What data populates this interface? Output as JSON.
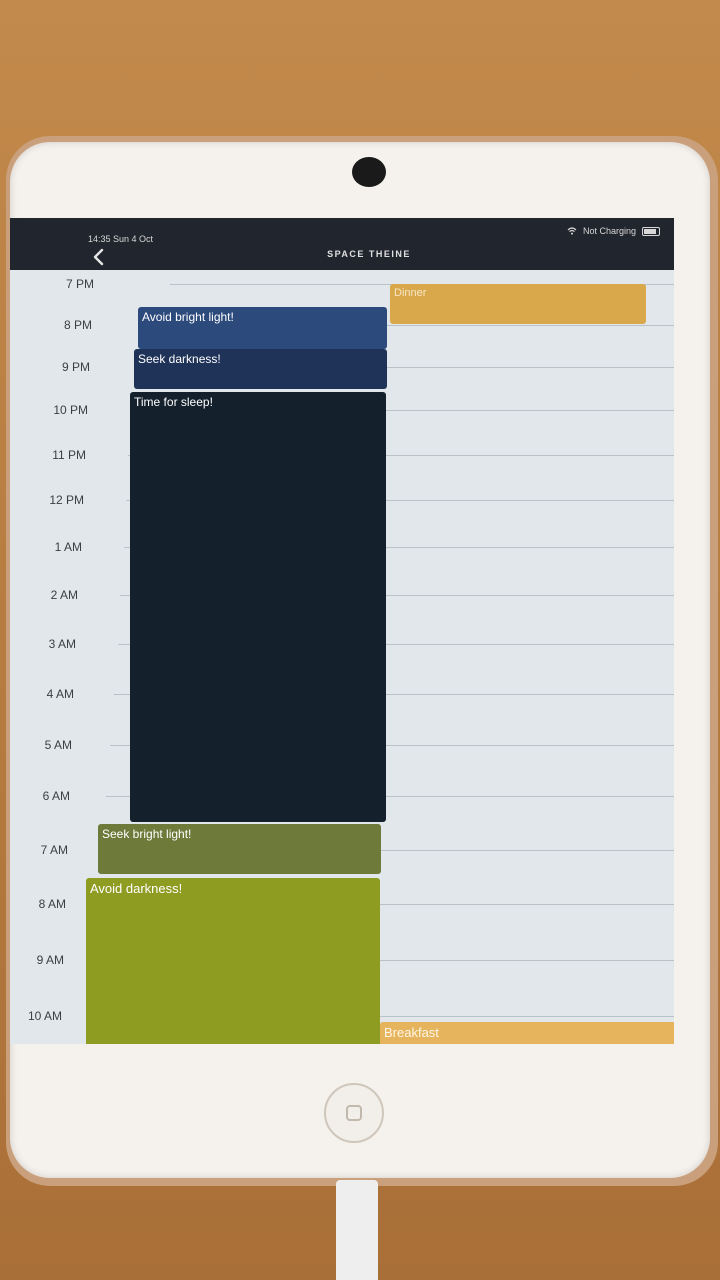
{
  "status_bar": {
    "time": "14:35  Sun 4 Oct",
    "charging": "Not Charging"
  },
  "nav": {
    "title": "SPACE THEINE",
    "back_icon": "chevron-left-icon"
  },
  "timeline": {
    "hours": [
      "7 PM",
      "8 PM",
      "9 PM",
      "10 PM",
      "11 PM",
      "12 PM",
      "1 AM",
      "2 AM",
      "3 AM",
      "4 AM",
      "5 AM",
      "6 AM",
      "7 AM",
      "8 AM",
      "9 AM",
      "10 AM"
    ],
    "events": [
      {
        "title": "Avoid bright light!",
        "color": "#2c4a7c"
      },
      {
        "title": "Seek darkness!",
        "color": "#1f3358"
      },
      {
        "title": "Time for sleep!",
        "color": "#14202c"
      },
      {
        "title": "Seek bright light!",
        "color": "#6d7a3a"
      },
      {
        "title": "Avoid darkness!",
        "color": "#8e9c22"
      },
      {
        "title": "Dinner",
        "color": "#d9a84a"
      },
      {
        "title": "Breakfast",
        "color": "#e6b45c"
      }
    ]
  },
  "colors": {
    "nav_background": "#21252e",
    "timeline_background": "#e1e7ea"
  }
}
